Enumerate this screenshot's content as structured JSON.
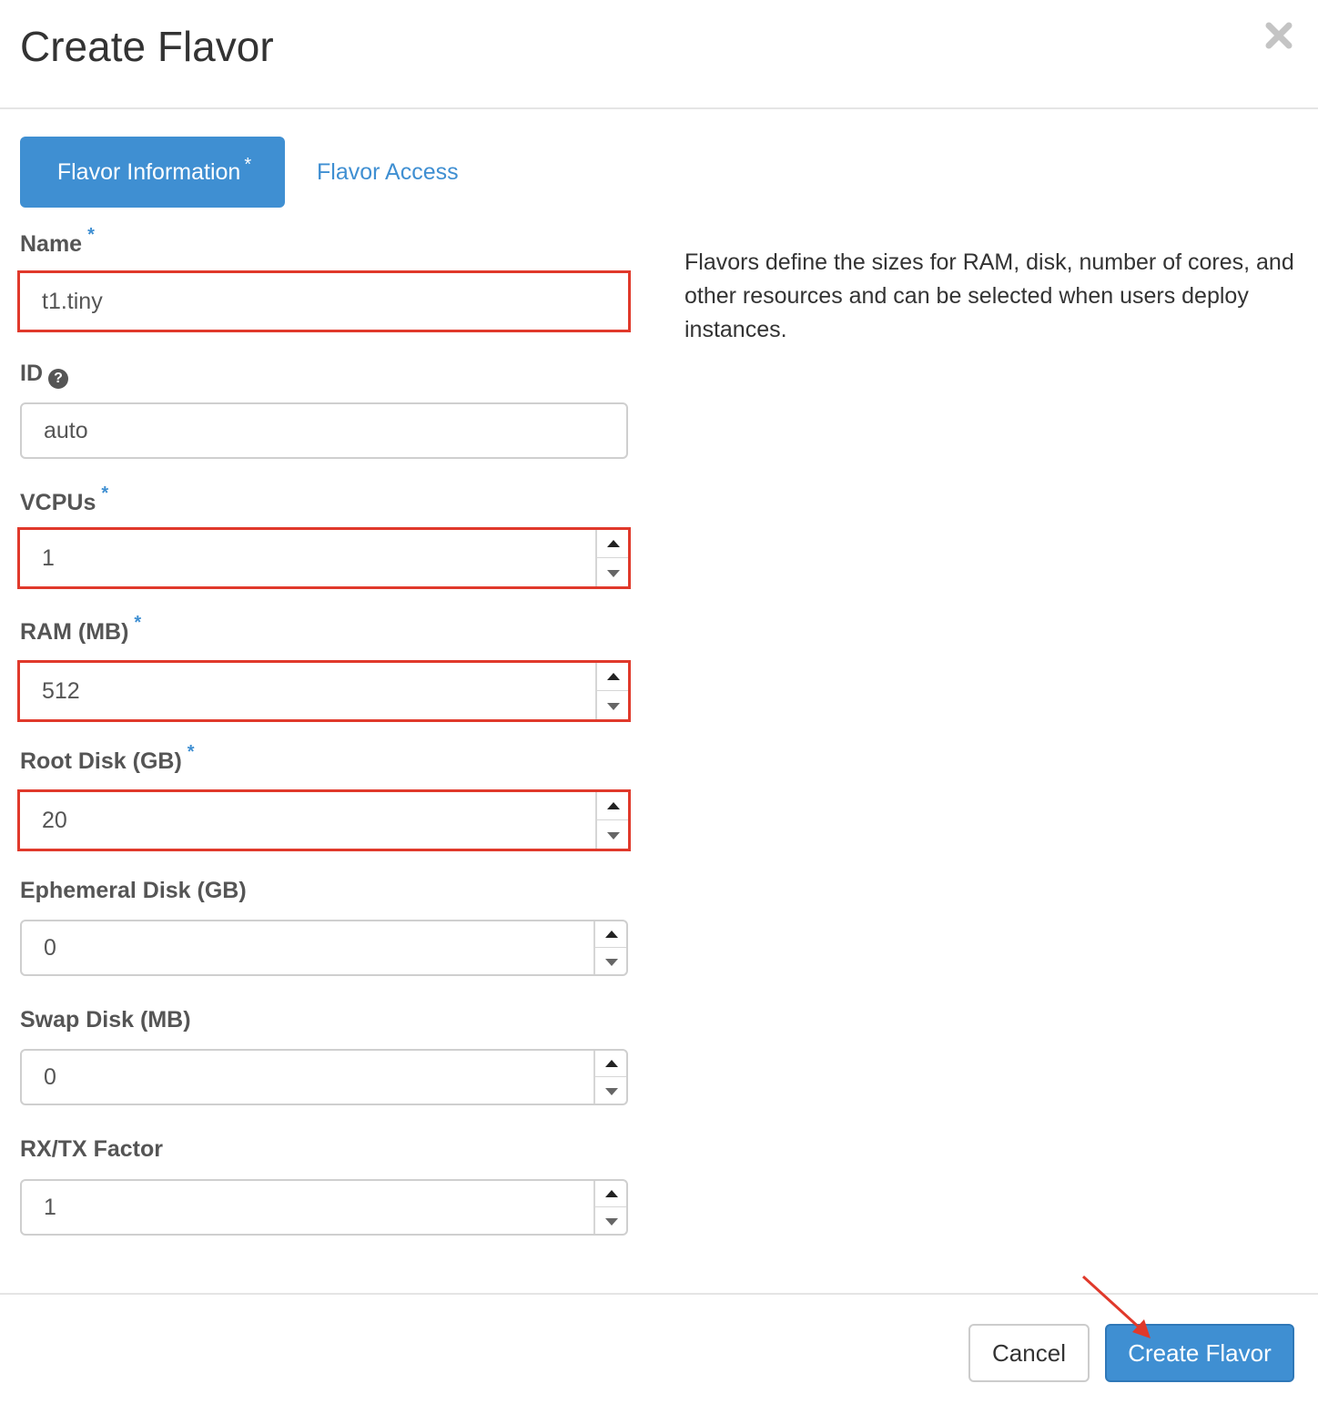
{
  "header": {
    "title": "Create Flavor"
  },
  "tabs": [
    {
      "label": "Flavor Information",
      "required_mark": "*",
      "active": true
    },
    {
      "label": "Flavor Access",
      "active": false
    }
  ],
  "form": {
    "name": {
      "label": "Name",
      "required_mark": "*",
      "value": "t1.tiny"
    },
    "id": {
      "label": "ID",
      "help_icon": "?",
      "value": "auto"
    },
    "vcpus": {
      "label": "VCPUs",
      "required_mark": "*",
      "value": "1"
    },
    "ram": {
      "label": "RAM (MB)",
      "required_mark": "*",
      "value": "512"
    },
    "root_disk": {
      "label": "Root Disk (GB)",
      "required_mark": "*",
      "value": "20"
    },
    "ephemeral_disk": {
      "label": "Ephemeral Disk (GB)",
      "value": "0"
    },
    "swap_disk": {
      "label": "Swap Disk (MB)",
      "value": "0"
    },
    "rxtx_factor": {
      "label": "RX/TX Factor",
      "value": "1"
    }
  },
  "description": "Flavors define the sizes for RAM, disk, number of cores, and other resources and can be selected when users deploy instances.",
  "footer": {
    "cancel_label": "Cancel",
    "submit_label": "Create Flavor"
  },
  "colors": {
    "primary": "#3f8fd2",
    "highlight": "#e0392b"
  }
}
